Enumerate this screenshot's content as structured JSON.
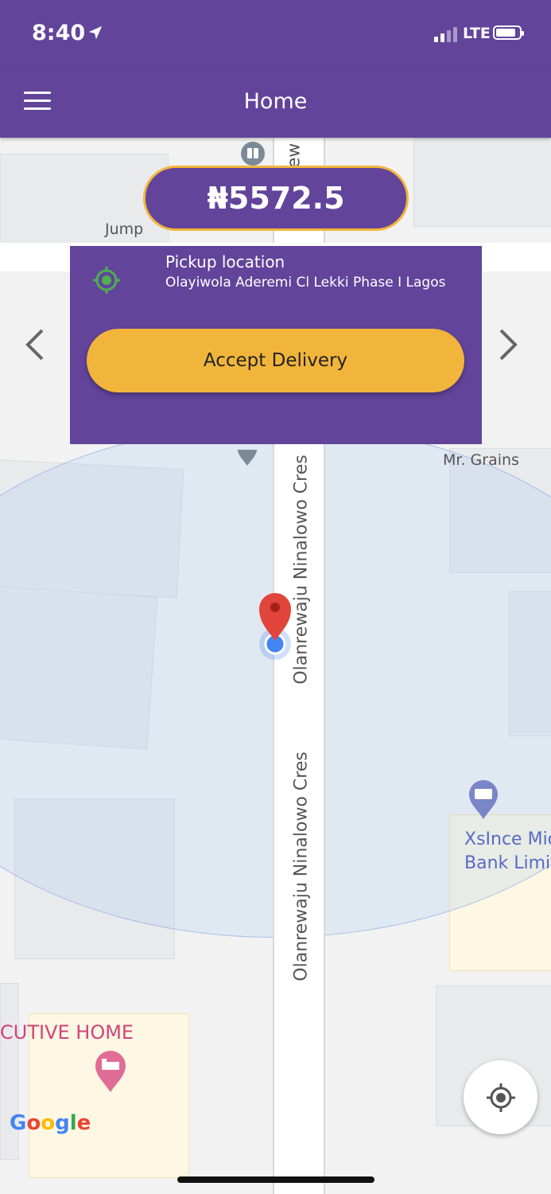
{
  "status_bar": {
    "time": "8:40",
    "network": "LTE"
  },
  "app_bar": {
    "title": "Home"
  },
  "delivery": {
    "price": "₦5572.5",
    "pickup_title": "Pickup location",
    "pickup_address": "Olayiwola Aderemi Cl Lekki Phase I Lagos",
    "accept_label": "Accept Delivery"
  },
  "map": {
    "street_name": "Olanrewaju Ninalowo Cres",
    "street_fragment": "ew",
    "poi_jumpr": "Jump",
    "poi_grains": "Mr. Grains",
    "poi_bank_line1": "XsInce Mic",
    "poi_bank_line2": "Bank Limit",
    "poi_home": "CUTIVE HOME",
    "google_letters": [
      "G",
      "o",
      "o",
      "g",
      "l",
      "e"
    ],
    "google_colors": [
      "#4285F4",
      "#EA4335",
      "#FBBC05",
      "#4285F4",
      "#34A853",
      "#EA4335"
    ]
  },
  "colors": {
    "primary": "#62449b",
    "accent": "#f2b53b",
    "pickup_icon": "#4caf50",
    "pin": "#e0443a"
  }
}
